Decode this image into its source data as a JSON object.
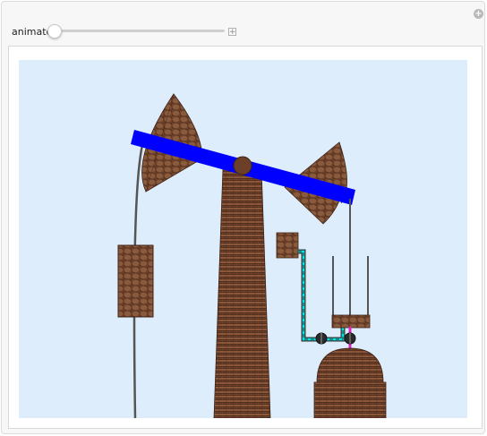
{
  "controls": {
    "animate_label": "animate",
    "animate_value": 0.0,
    "expand_symbol": "+",
    "panel_plus_symbol": "+"
  },
  "colors": {
    "background_sky": "#deedfc",
    "beam": "#0000ff",
    "brick": "#7a4a30",
    "brick_dark": "#3d2316",
    "cable": "#555555",
    "pipe_cyan": "#00e5e5",
    "rod_magenta": "#e020d0"
  },
  "icons": [
    "plus-circle-icon",
    "slider-expand-icon"
  ]
}
